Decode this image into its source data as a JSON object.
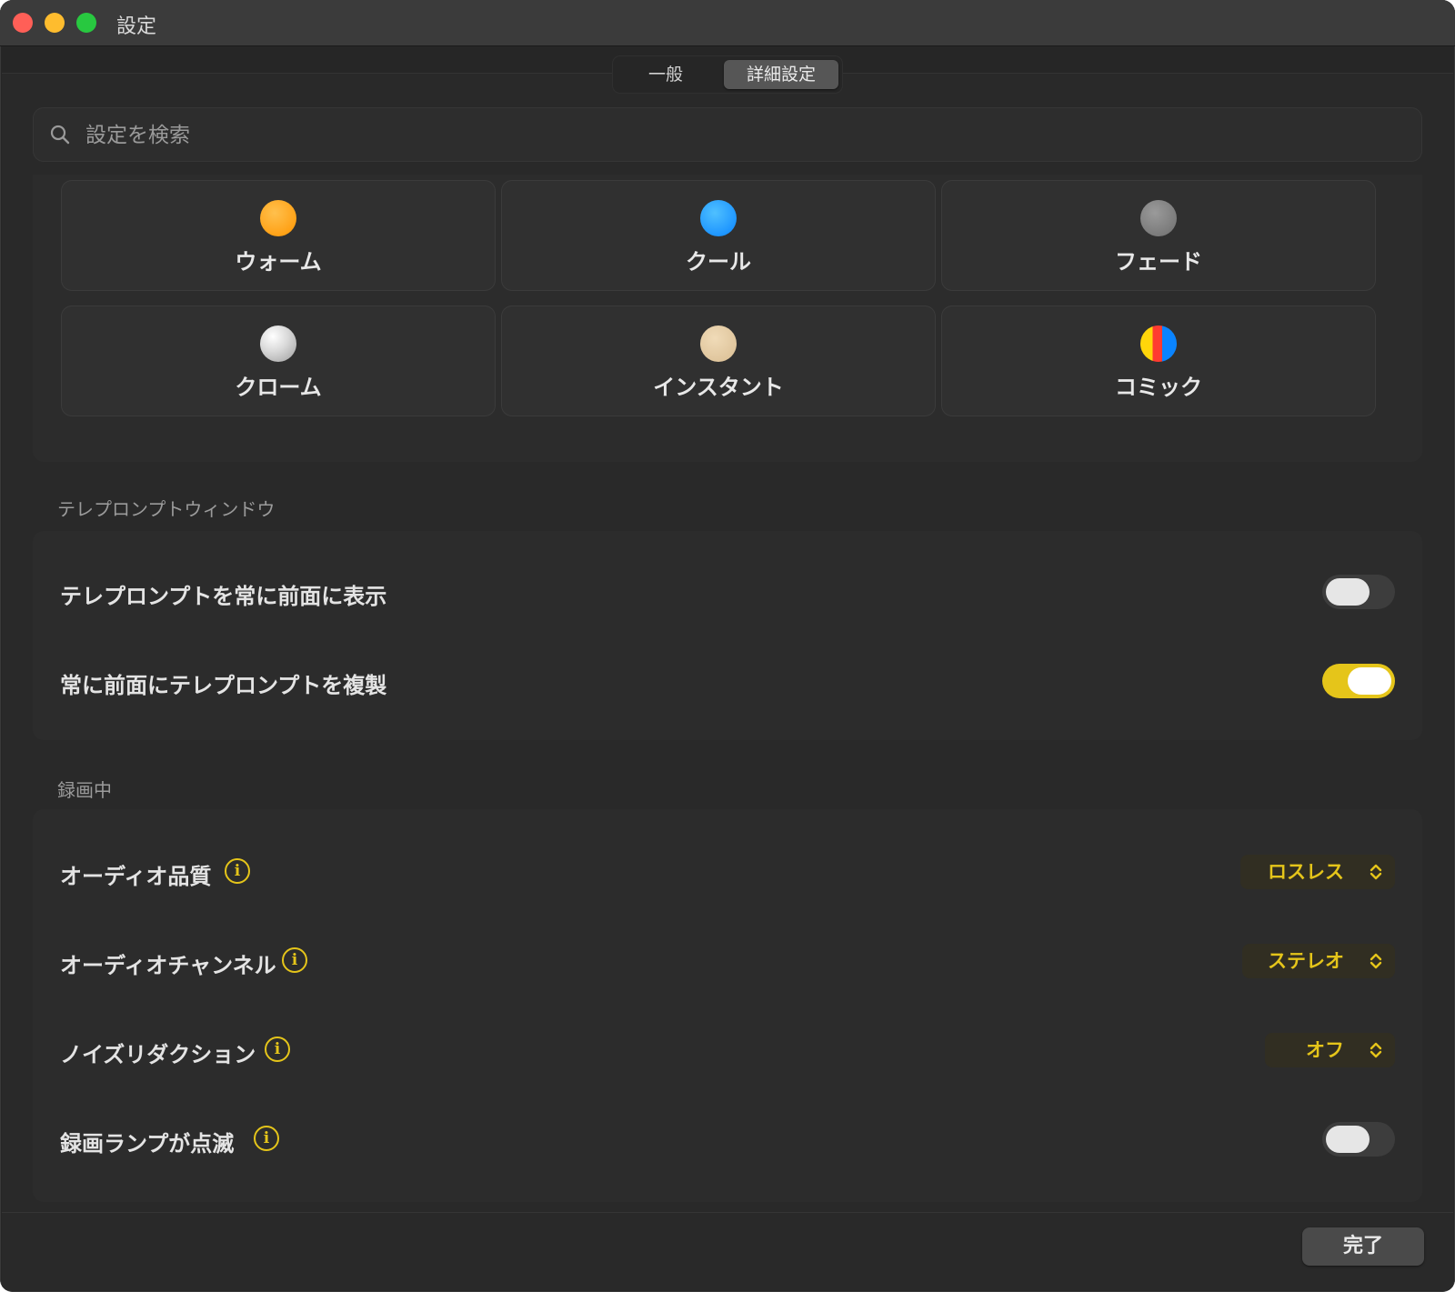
{
  "window": {
    "title": "設定"
  },
  "tabs": [
    {
      "label": "一般",
      "selected": false
    },
    {
      "label": "詳細設定",
      "selected": true
    }
  ],
  "search": {
    "placeholder": "設定を検索"
  },
  "themes": [
    {
      "label": "ウォーム",
      "color": "#ff9f0a"
    },
    {
      "label": "クール",
      "color": "#0a9eff"
    },
    {
      "label": "フェード",
      "color": "#7f7f7f"
    },
    {
      "label": "クローム",
      "color": "#e0e0e0"
    },
    {
      "label": "インスタント",
      "color": "#e3c9a2"
    },
    {
      "label": "コミック",
      "color": "multicolor"
    }
  ],
  "teleprompter": {
    "section_title": "テレプロンプトウィンドウ",
    "always_on_top": {
      "label": "テレプロンプトを常に前面に表示",
      "enabled": false
    },
    "duplicate_on_top": {
      "label": "常に前面にテレプロンプトを複製",
      "enabled": true
    }
  },
  "recording": {
    "section_title": "録画中",
    "audio_quality": {
      "label": "オーディオ品質",
      "value": "ロスレス"
    },
    "audio_channel": {
      "label": "オーディオチャンネル",
      "value": "ステレオ"
    },
    "noise_reduction": {
      "label": "ノイズリダクション",
      "value": "オフ"
    },
    "recording_lamp_blink": {
      "label": "録画ランプが点滅",
      "enabled": false
    }
  },
  "footer": {
    "done_label": "完了"
  },
  "colors": {
    "accent": "#e5c51a"
  }
}
